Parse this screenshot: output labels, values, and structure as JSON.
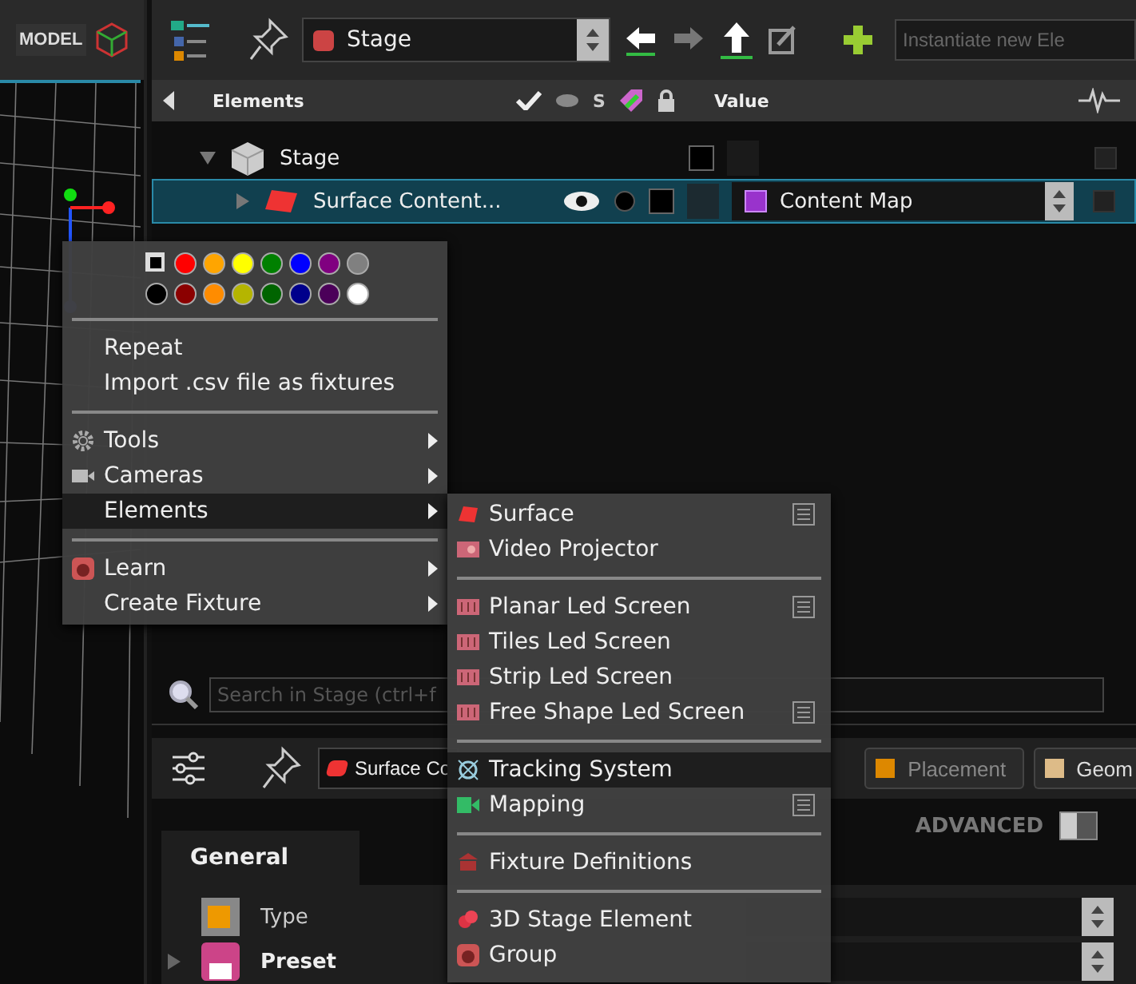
{
  "viewport": {
    "mode_button": "MODEL"
  },
  "toolbar": {
    "stage_select": "Stage",
    "instantiate": {
      "placeholder": "Instantiate new Ele"
    }
  },
  "tree_header": {
    "elements": "Elements",
    "solo": "S",
    "value": "Value"
  },
  "tree": [
    {
      "label": "Stage",
      "expanded": true,
      "selected": false,
      "children": [
        {
          "label": "Surface Content...",
          "selected": true,
          "visible": true,
          "value": "Content Map"
        }
      ]
    }
  ],
  "search": {
    "placeholder": "Search in Stage (ctrl+f"
  },
  "inspector": {
    "element": "Surface Co",
    "tabs": [
      {
        "label": "Placement",
        "selected": false
      },
      {
        "label": "Geom",
        "selected": false
      }
    ],
    "advanced": {
      "label": "ADVANCED",
      "on": false
    },
    "section_tab": "General",
    "properties": [
      {
        "label": "Type",
        "bold": false
      },
      {
        "label": "Preset",
        "bold": true
      }
    ]
  },
  "context_menu": {
    "colors": [
      {
        "kind": "none",
        "color": "#000000"
      },
      {
        "kind": "swatch",
        "color": "#ff0000"
      },
      {
        "kind": "swatch",
        "color": "#ffa500"
      },
      {
        "kind": "swatch",
        "color": "#ffff00"
      },
      {
        "kind": "swatch",
        "color": "#008000"
      },
      {
        "kind": "swatch",
        "color": "#0000ff"
      },
      {
        "kind": "swatch",
        "color": "#800080"
      },
      {
        "kind": "swatch",
        "color": "#808080"
      },
      {
        "kind": "swatch",
        "color": "#000000"
      },
      {
        "kind": "swatch",
        "color": "#8b0000"
      },
      {
        "kind": "swatch",
        "color": "#ff8c00"
      },
      {
        "kind": "swatch",
        "color": "#b5b500"
      },
      {
        "kind": "swatch",
        "color": "#006400"
      },
      {
        "kind": "swatch",
        "color": "#00008b"
      },
      {
        "kind": "swatch",
        "color": "#4b0059"
      },
      {
        "kind": "swatch",
        "color": "#ffffff"
      }
    ],
    "groups": [
      [
        {
          "label": "Repeat",
          "submenu": false,
          "selected": false
        },
        {
          "label": "Import .csv file as fixtures",
          "submenu": false,
          "selected": false
        }
      ],
      [
        {
          "label": "Tools",
          "submenu": true,
          "selected": false
        },
        {
          "label": "Cameras",
          "submenu": true,
          "selected": false
        },
        {
          "label": "Elements",
          "submenu": true,
          "selected": true
        }
      ],
      [
        {
          "label": "Learn",
          "submenu": true,
          "selected": false
        },
        {
          "label": "Create Fixture",
          "submenu": true,
          "selected": false
        }
      ]
    ]
  },
  "submenu": {
    "groups": [
      [
        {
          "label": "Surface",
          "options": true,
          "selected": false
        },
        {
          "label": "Video Projector",
          "options": false,
          "selected": false
        }
      ],
      [
        {
          "label": "Planar Led Screen",
          "options": true,
          "selected": false
        },
        {
          "label": "Tiles Led Screen",
          "options": false,
          "selected": false
        },
        {
          "label": "Strip Led Screen",
          "options": false,
          "selected": false
        },
        {
          "label": "Free Shape Led Screen",
          "options": true,
          "selected": false
        }
      ],
      [
        {
          "label": "Tracking System",
          "options": false,
          "selected": true
        },
        {
          "label": "Mapping",
          "options": true,
          "selected": false
        }
      ],
      [
        {
          "label": "Fixture Definitions",
          "options": false,
          "selected": false
        }
      ],
      [
        {
          "label": "3D Stage Element",
          "options": false,
          "selected": false
        },
        {
          "label": "Group",
          "options": false,
          "selected": false
        }
      ]
    ]
  }
}
